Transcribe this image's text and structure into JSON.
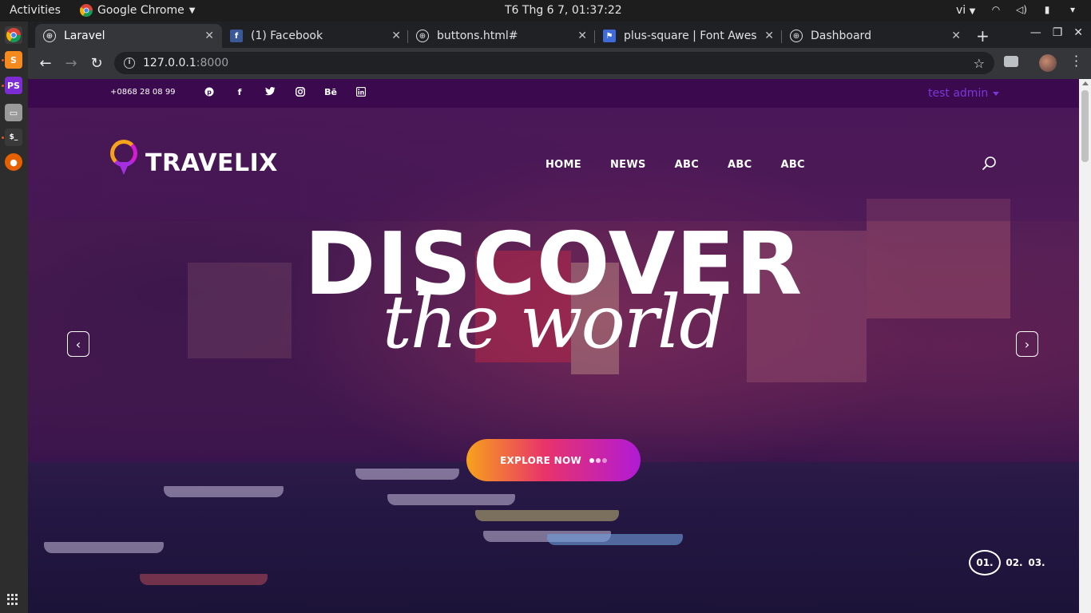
{
  "system": {
    "activities": "Activities",
    "app_name": "Google Chrome",
    "clock": "T6 Thg 6  7, 01:37:22",
    "lang": "vi"
  },
  "browser": {
    "tabs": [
      {
        "title": "Laravel",
        "active": true
      },
      {
        "title": "(1) Facebook",
        "active": false
      },
      {
        "title": "buttons.html#",
        "active": false
      },
      {
        "title": "plus-square | Font Awesc",
        "active": false
      },
      {
        "title": "Dashboard",
        "active": false
      }
    ],
    "url_host": "127.0.0.1",
    "url_port": ":8000"
  },
  "site": {
    "phone": "+0868 28 08 99",
    "socials": [
      "pinterest-icon",
      "facebook-icon",
      "twitter-icon",
      "instagram-icon",
      "behance-icon",
      "linkedin-icon"
    ],
    "behance_label": "Bē",
    "user": "test admin",
    "logo_text": "TRAVELIX",
    "nav": [
      "HOME",
      "NEWS",
      "ABC",
      "ABC",
      "ABC"
    ],
    "hero_title": "DISCOVER",
    "hero_subtitle": "the world",
    "explore_label": "EXPLORE NOW",
    "pager": [
      "01.",
      "02.",
      "03."
    ],
    "colors": {
      "topbar": "#3b0a4e",
      "user_link": "#7b36d9",
      "button_gradient_start": "#f7a21b",
      "button_gradient_end": "#b11ad6"
    }
  }
}
